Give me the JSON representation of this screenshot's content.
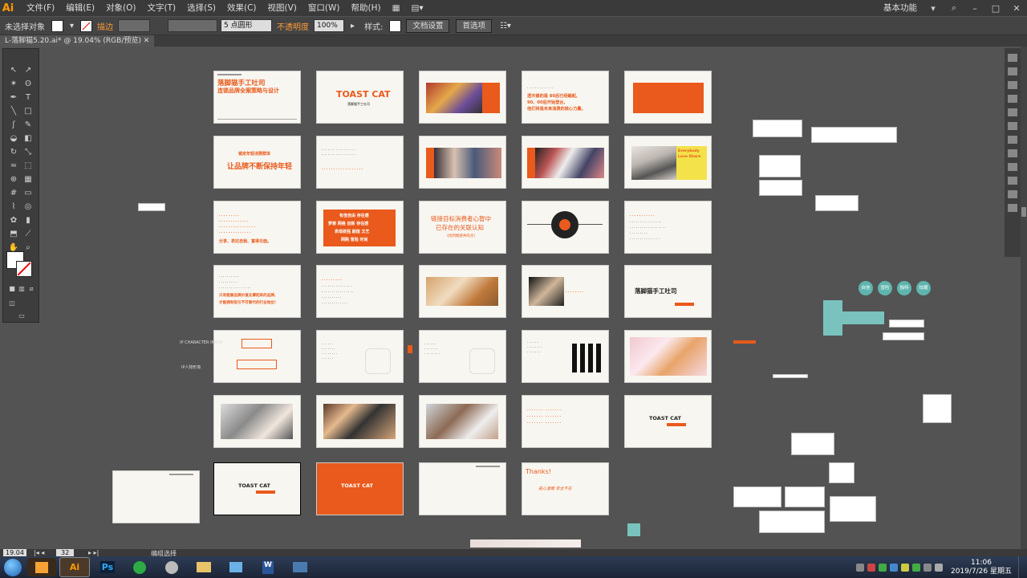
{
  "app": {
    "logo": "Ai"
  },
  "menus": [
    "文件(F)",
    "编辑(E)",
    "对象(O)",
    "文字(T)",
    "选择(S)",
    "效果(C)",
    "视图(V)",
    "窗口(W)",
    "帮助(H)"
  ],
  "workspace": "基本功能",
  "control": {
    "selection": "未选择对象",
    "stroke_label": "描边",
    "brush": "5 点圆形",
    "opacity_label": "不透明度",
    "opacity_value": "100%",
    "style_label": "样式:",
    "doc_setup": "文档设置",
    "prefs": "首选项"
  },
  "document_tab": "L-落脚猫5.20.ai* @ 19.04% (RGB/预览)",
  "status": {
    "zoom": "19.04",
    "artboard": "32",
    "tool": "编组选择"
  },
  "slides": {
    "s1_title": "落脚猫手工吐司",
    "s1_sub": "连锁品牌全案策略与设计",
    "s2_logo": "TOAST CAT",
    "s2_sub": "落脚猫手工吐司",
    "s4_text1": "透天锁的是 80后已经崛起,",
    "s4_text2": "90、00后开始登台,",
    "s4_text3": "他们将是未来消费的核心力量。",
    "s6_title": "锁定年轻消费群体",
    "s6_main": "让品牌不断保持年轻",
    "s8_head": "Everybody",
    "s8_head2": "Love Share",
    "s11_text": "分享、表达自我、富得日面。",
    "s12_row1": "有佳自由 存在感",
    "s12_row2": "梦想 网络 创新 存在感",
    "s12_row3": "表现欲强 颜值 文艺",
    "s12_row4": "网购 冒险 时尚",
    "s13_l1": "链接目标消费者心智中",
    "s13_l2": "已存在的关联认知",
    "s13_l3": "(找到情感共鸣点)",
    "s16_l1": "只有能展品牌价值支撑起来的品牌,",
    "s16_l2": "才能拥有吸引不可替代的行业地位!",
    "s20_title": "落脚猫手工吐司",
    "s21_note": "IP CHARACTER IMAGE",
    "s21_note2": "IP人物形象",
    "s34_thanks": "Thanks!",
    "s34_sign": "是心温暖 安全不在"
  },
  "circles": [
    "自信",
    "冒险",
    "独特",
    "炫耀"
  ],
  "taskbar": {
    "clock_time": "11:06",
    "clock_date": "2019/7/26 星期五"
  },
  "colors": {
    "accent": "#e95a1c",
    "teal": "#5fb5ae"
  }
}
